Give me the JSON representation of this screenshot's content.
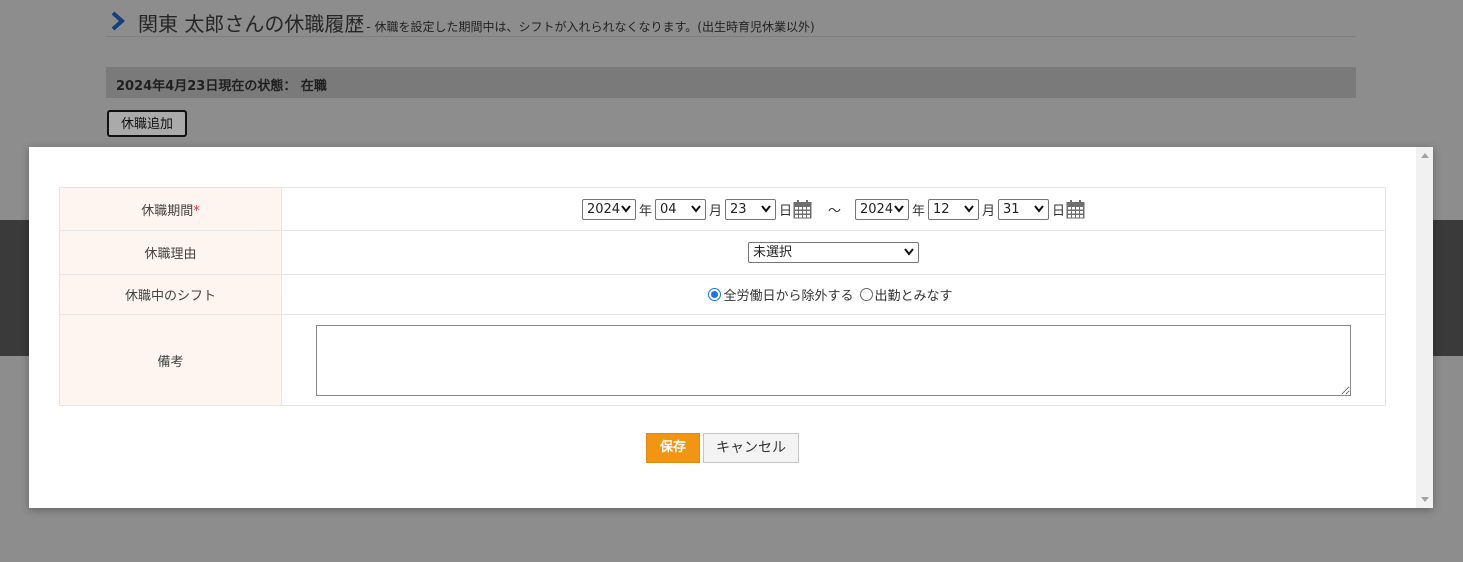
{
  "header": {
    "title": "関東 太郎さんの休職履歴",
    "subtitle": "- 休職を設定した期間中は、シフトが入れられなくなります。(出生時育児休業以外)"
  },
  "status": {
    "text": "2024年4月23日現在の状態： 在職"
  },
  "add_button": {
    "label": "休職追加"
  },
  "form": {
    "period": {
      "label": "休職期間",
      "required_mark": "*",
      "start": {
        "year": "2024",
        "month": "04",
        "day": "23"
      },
      "end": {
        "year": "2024",
        "month": "12",
        "day": "31"
      },
      "unit_year": "年",
      "unit_month": "月",
      "unit_day": "日",
      "separator": "～"
    },
    "reason": {
      "label": "休職理由",
      "selected": "未選択"
    },
    "shift": {
      "label": "休職中のシフト",
      "options": [
        "全労働日から除外する",
        "出勤とみなす"
      ],
      "selected_index": 0
    },
    "note": {
      "label": "備考",
      "value": ""
    }
  },
  "actions": {
    "save": "保存",
    "cancel": "キャンセル"
  },
  "colors": {
    "accent": "#f29513",
    "chevron": "#1a5fb4",
    "label_bg": "#fef5f0",
    "radio": "#1a73e8",
    "required": "#d33333"
  }
}
